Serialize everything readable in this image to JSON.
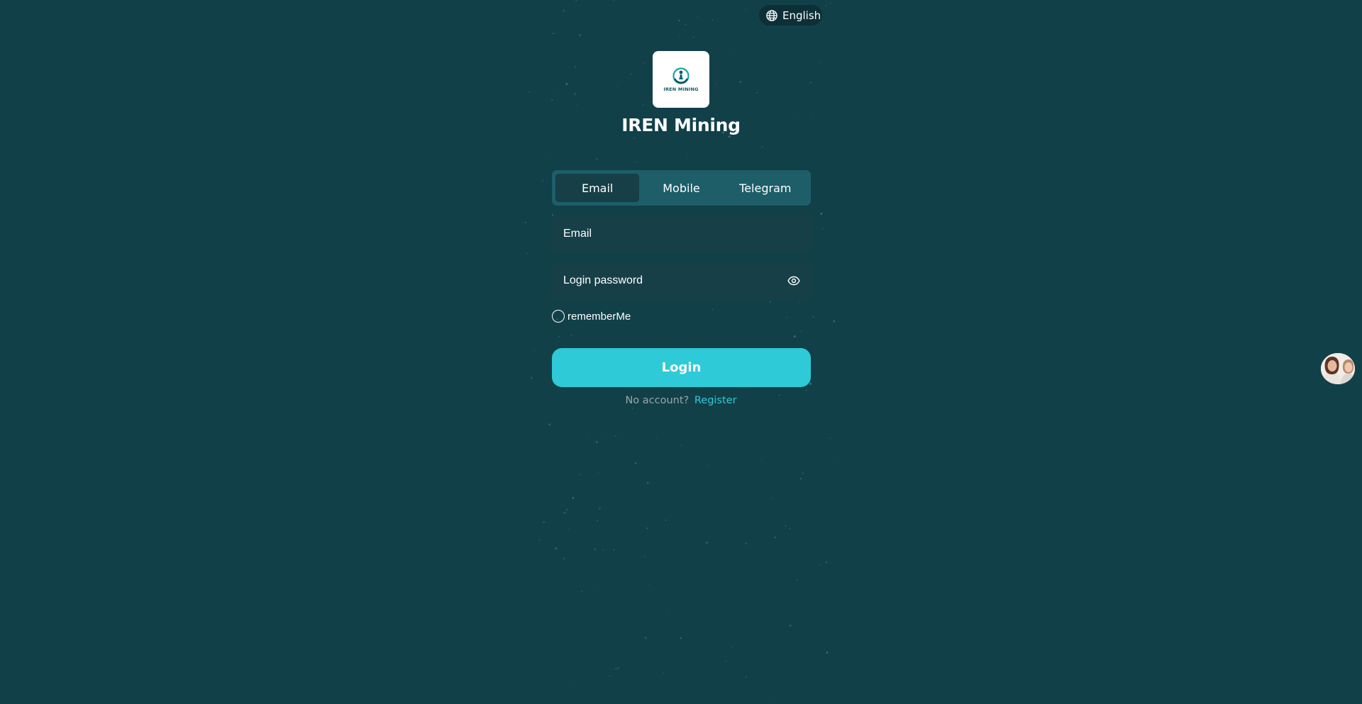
{
  "header": {
    "language_label": "English",
    "language_icon": "globe-icon"
  },
  "brand": {
    "logo_text": "IREN MINING",
    "app_title": "IREN Mining"
  },
  "login_tabs": [
    {
      "label": "Email",
      "active": true
    },
    {
      "label": "Mobile",
      "active": false
    },
    {
      "label": "Telegram",
      "active": false
    }
  ],
  "form": {
    "email_placeholder": "Email",
    "email_value": "",
    "password_placeholder": "Login password",
    "password_value": "",
    "password_toggle_icon": "eye-icon",
    "remember_label": "rememberMe",
    "remember_checked": false,
    "login_label": "Login"
  },
  "footer": {
    "no_account_text": "No account?",
    "register_label": "Register"
  },
  "support": {
    "icon": "customer-service-avatar"
  },
  "colors": {
    "background": "#114049",
    "accent": "#2ecad7",
    "tab_bar": "#1d5e68",
    "tab_active": "#163f47",
    "input_bg": "#173f48"
  }
}
